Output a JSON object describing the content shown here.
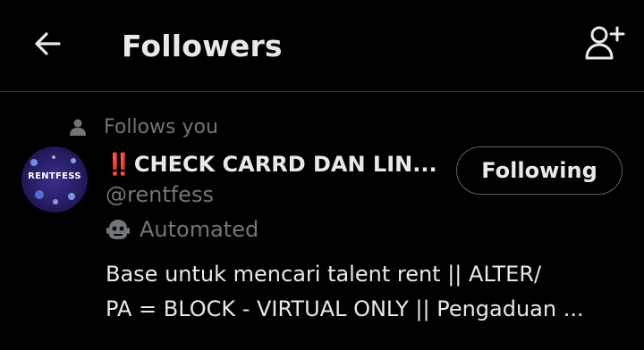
{
  "header": {
    "title": "Followers",
    "back_icon": "arrow-left-icon",
    "add_icon": "add-user-icon"
  },
  "colors": {
    "background": "#000000",
    "text_primary": "#e7e9ea",
    "text_secondary": "#71767b",
    "divider": "#2f3336",
    "button_border": "#536471",
    "alert_red": "#e0245e"
  },
  "follower": {
    "follows_you_label": "Follows you",
    "avatar_text": "RENTFESS",
    "name_prefix": "‼️",
    "display_name": "CHECK CARRD DAN LIN...",
    "handle": "@rentfess",
    "automated_label": "Automated",
    "follow_button_label": "Following",
    "bio_lines": [
      "Base untuk mencari talent rent || ALTER/",
      "PA = BLOCK - VIRTUAL ONLY || Pengaduan ..."
    ]
  }
}
